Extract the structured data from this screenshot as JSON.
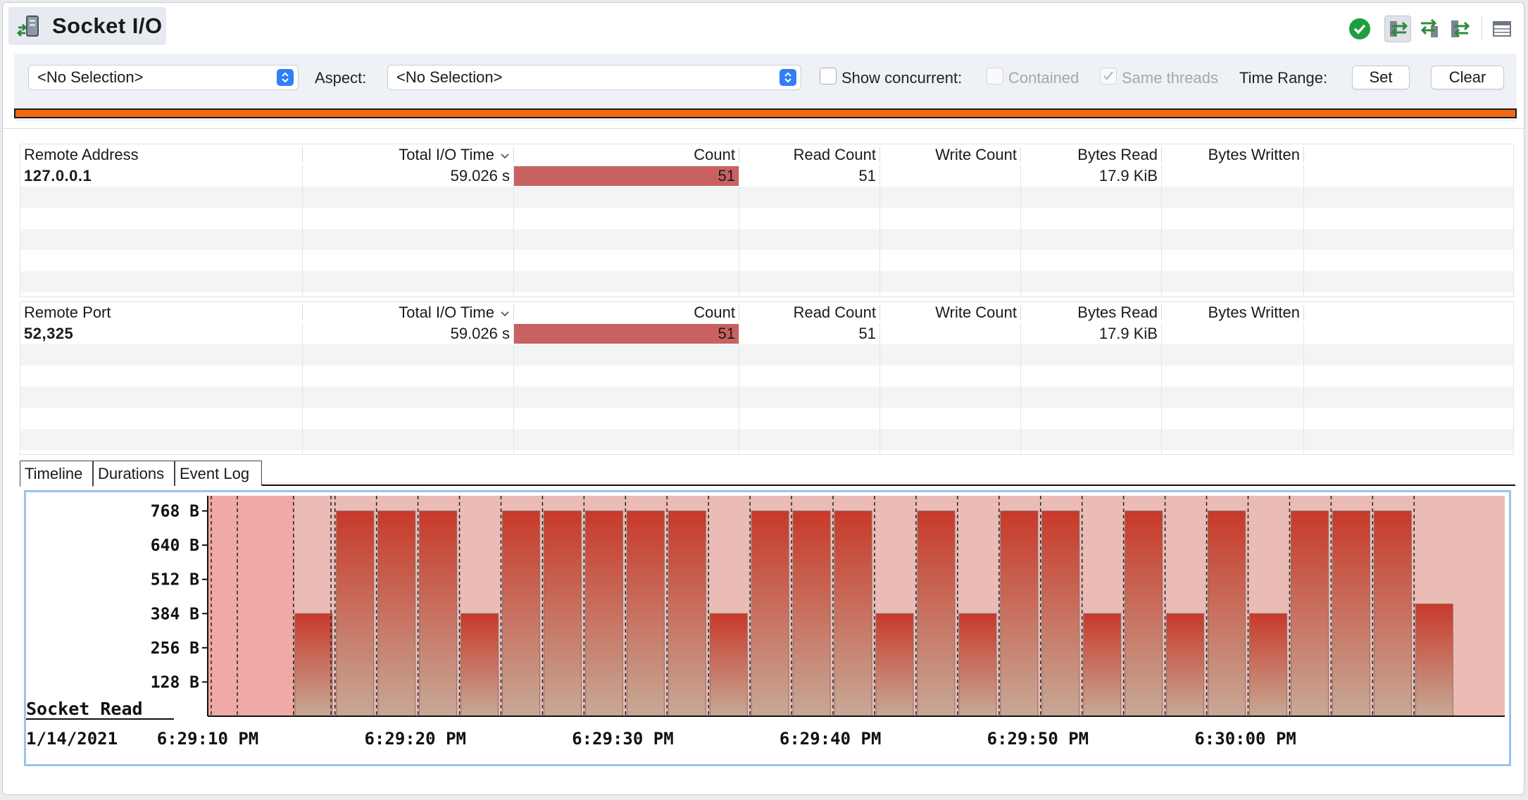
{
  "title": "Socket I/O",
  "icons": {
    "title": "socket-io-icon",
    "status": "green-check-icon",
    "toolbar": [
      "socket-arrows-icon",
      "socket-arrows-in-icon",
      "socket-arrows-out-icon",
      "table-view-icon"
    ]
  },
  "filter": {
    "selection_value": "<No Selection>",
    "aspect_label": "Aspect:",
    "aspect_value": "<No Selection>",
    "show_concurrent_label": "Show concurrent:",
    "show_concurrent_checked": false,
    "contained_label": "Contained",
    "contained_checked": false,
    "same_threads_label": "Same threads",
    "same_threads_checked": true,
    "time_range_label": "Time Range:",
    "set_label": "Set",
    "clear_label": "Clear"
  },
  "table_address": {
    "columns": [
      "Remote Address",
      "Total I/O Time",
      "Count",
      "Read Count",
      "Write Count",
      "Bytes Read",
      "Bytes Written"
    ],
    "rows": [
      {
        "key": "127.0.0.1",
        "total_io_time": "59.026 s",
        "count": "51",
        "read_count": "51",
        "write_count": "",
        "bytes_read": "17.9 KiB",
        "bytes_written": ""
      }
    ]
  },
  "table_port": {
    "columns": [
      "Remote Port",
      "Total I/O Time",
      "Count",
      "Read Count",
      "Write Count",
      "Bytes Read",
      "Bytes Written"
    ],
    "rows": [
      {
        "key": "52,325",
        "total_io_time": "59.026 s",
        "count": "51",
        "read_count": "51",
        "write_count": "",
        "bytes_read": "17.9 KiB",
        "bytes_written": ""
      }
    ]
  },
  "tabs": [
    "Timeline",
    "Durations",
    "Event Log"
  ],
  "active_tab": "Timeline",
  "chart_data": {
    "type": "bar",
    "series_label": "Socket Read",
    "date_label": "1/14/2021",
    "y_ticks": [
      "128 B",
      "256 B",
      "384 B",
      "512 B",
      "640 B",
      "768 B"
    ],
    "y_tick_values": [
      128,
      256,
      384,
      512,
      640,
      768
    ],
    "ylim": [
      0,
      800
    ],
    "x_ticks": [
      "6:29:10 PM",
      "6:29:20 PM",
      "6:29:30 PM",
      "6:29:40 PM",
      "6:29:50 PM",
      "6:30:00 PM"
    ],
    "x_tick_seconds": [
      10,
      20,
      30,
      40,
      50,
      60
    ],
    "x_range_seconds": [
      10,
      72.5
    ],
    "bars": [
      {
        "start": 14.2,
        "end": 16.0,
        "value": 384
      },
      {
        "start": 16.2,
        "end": 18.0,
        "value": 768
      },
      {
        "start": 18.2,
        "end": 20.0,
        "value": 768
      },
      {
        "start": 20.2,
        "end": 22.0,
        "value": 768
      },
      {
        "start": 22.2,
        "end": 24.0,
        "value": 384
      },
      {
        "start": 24.2,
        "end": 26.0,
        "value": 768
      },
      {
        "start": 26.2,
        "end": 28.0,
        "value": 768
      },
      {
        "start": 28.2,
        "end": 30.0,
        "value": 768
      },
      {
        "start": 30.2,
        "end": 32.0,
        "value": 768
      },
      {
        "start": 32.2,
        "end": 34.0,
        "value": 768
      },
      {
        "start": 34.2,
        "end": 36.0,
        "value": 384
      },
      {
        "start": 36.2,
        "end": 38.0,
        "value": 768
      },
      {
        "start": 38.2,
        "end": 40.0,
        "value": 768
      },
      {
        "start": 40.2,
        "end": 42.0,
        "value": 768
      },
      {
        "start": 42.2,
        "end": 44.0,
        "value": 384
      },
      {
        "start": 44.2,
        "end": 46.0,
        "value": 768
      },
      {
        "start": 46.2,
        "end": 48.0,
        "value": 384
      },
      {
        "start": 48.2,
        "end": 50.0,
        "value": 768
      },
      {
        "start": 50.2,
        "end": 52.0,
        "value": 768
      },
      {
        "start": 52.2,
        "end": 54.0,
        "value": 384
      },
      {
        "start": 54.2,
        "end": 56.0,
        "value": 768
      },
      {
        "start": 56.2,
        "end": 58.0,
        "value": 384
      },
      {
        "start": 58.2,
        "end": 60.0,
        "value": 768
      },
      {
        "start": 60.2,
        "end": 62.0,
        "value": 384
      },
      {
        "start": 62.2,
        "end": 64.0,
        "value": 768
      },
      {
        "start": 64.2,
        "end": 66.0,
        "value": 768
      },
      {
        "start": 66.2,
        "end": 68.0,
        "value": 768
      },
      {
        "start": 68.2,
        "end": 70.0,
        "value": 420
      }
    ],
    "colors": {
      "bar_top": "#c8392a",
      "bar_bottom": "#c7a996",
      "background_band": "#ebbbb6",
      "first_band": "#efaaa5"
    }
  }
}
